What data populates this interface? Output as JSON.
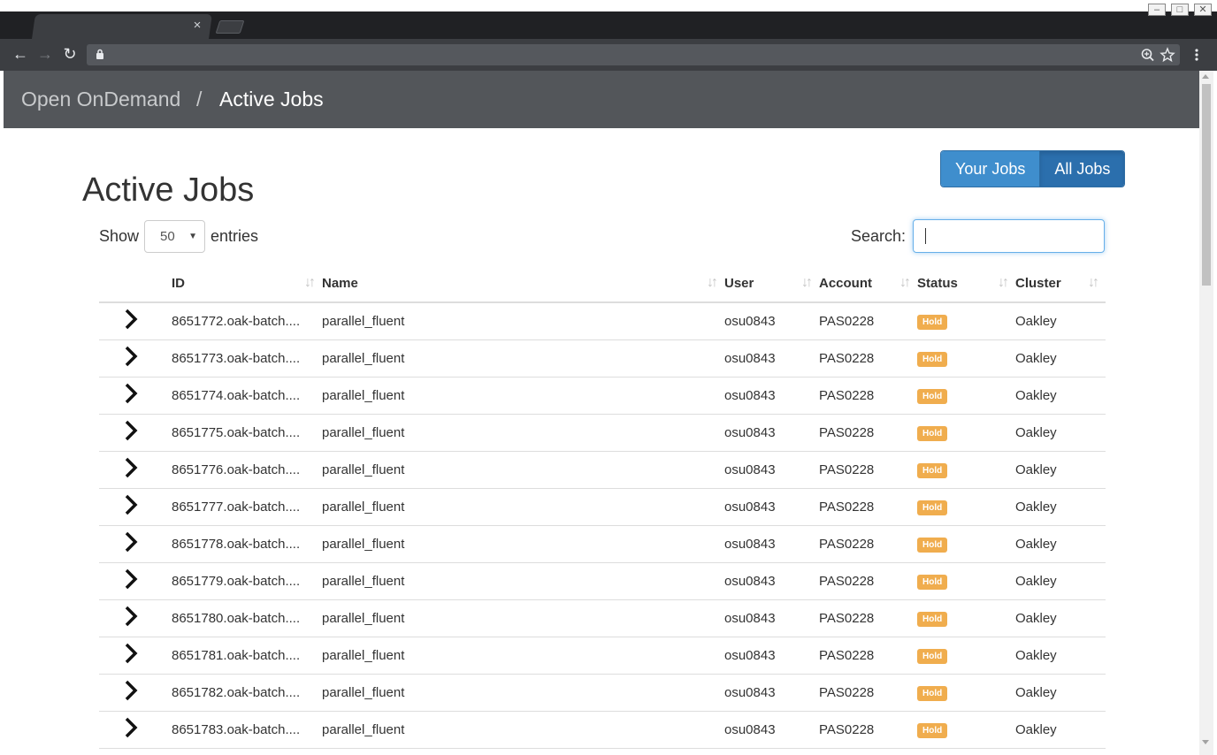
{
  "browser": {
    "tab_close": "×",
    "nav": {
      "back": "←",
      "forward": "→",
      "reload": "↻"
    },
    "icons": {
      "lock": "lock-icon",
      "zoom": "zoom-icon",
      "star": "star-icon",
      "menu": "menu-icon"
    },
    "window_controls": [
      "‒",
      "□",
      "✕"
    ]
  },
  "navbar": {
    "brand": "Open OnDemand",
    "separator": "/",
    "current": "Active Jobs"
  },
  "page": {
    "title": "Active Jobs",
    "filter_buttons": {
      "your_jobs": "Your Jobs",
      "all_jobs": "All Jobs",
      "active": "all_jobs"
    },
    "length": {
      "prefix": "Show",
      "value": "50",
      "suffix": "entries"
    },
    "search": {
      "label": "Search:",
      "value": ""
    }
  },
  "table": {
    "columns": [
      "ID",
      "Name",
      "User",
      "Account",
      "Status",
      "Cluster"
    ],
    "rows": [
      {
        "id": "8651772.oak-batch....",
        "name": "parallel_fluent",
        "user": "osu0843",
        "account": "PAS0228",
        "status": "Hold",
        "cluster": "Oakley"
      },
      {
        "id": "8651773.oak-batch....",
        "name": "parallel_fluent",
        "user": "osu0843",
        "account": "PAS0228",
        "status": "Hold",
        "cluster": "Oakley"
      },
      {
        "id": "8651774.oak-batch....",
        "name": "parallel_fluent",
        "user": "osu0843",
        "account": "PAS0228",
        "status": "Hold",
        "cluster": "Oakley"
      },
      {
        "id": "8651775.oak-batch....",
        "name": "parallel_fluent",
        "user": "osu0843",
        "account": "PAS0228",
        "status": "Hold",
        "cluster": "Oakley"
      },
      {
        "id": "8651776.oak-batch....",
        "name": "parallel_fluent",
        "user": "osu0843",
        "account": "PAS0228",
        "status": "Hold",
        "cluster": "Oakley"
      },
      {
        "id": "8651777.oak-batch....",
        "name": "parallel_fluent",
        "user": "osu0843",
        "account": "PAS0228",
        "status": "Hold",
        "cluster": "Oakley"
      },
      {
        "id": "8651778.oak-batch....",
        "name": "parallel_fluent",
        "user": "osu0843",
        "account": "PAS0228",
        "status": "Hold",
        "cluster": "Oakley"
      },
      {
        "id": "8651779.oak-batch....",
        "name": "parallel_fluent",
        "user": "osu0843",
        "account": "PAS0228",
        "status": "Hold",
        "cluster": "Oakley"
      },
      {
        "id": "8651780.oak-batch....",
        "name": "parallel_fluent",
        "user": "osu0843",
        "account": "PAS0228",
        "status": "Hold",
        "cluster": "Oakley"
      },
      {
        "id": "8651781.oak-batch....",
        "name": "parallel_fluent",
        "user": "osu0843",
        "account": "PAS0228",
        "status": "Hold",
        "cluster": "Oakley"
      },
      {
        "id": "8651782.oak-batch....",
        "name": "parallel_fluent",
        "user": "osu0843",
        "account": "PAS0228",
        "status": "Hold",
        "cluster": "Oakley"
      },
      {
        "id": "8651783.oak-batch....",
        "name": "parallel_fluent",
        "user": "osu0843",
        "account": "PAS0228",
        "status": "Hold",
        "cluster": "Oakley"
      }
    ]
  },
  "colors": {
    "navbar": "#53565a",
    "button_primary": "#3f8ecd",
    "button_active": "#2b6fad",
    "badge_hold": "#f0ad4e"
  }
}
